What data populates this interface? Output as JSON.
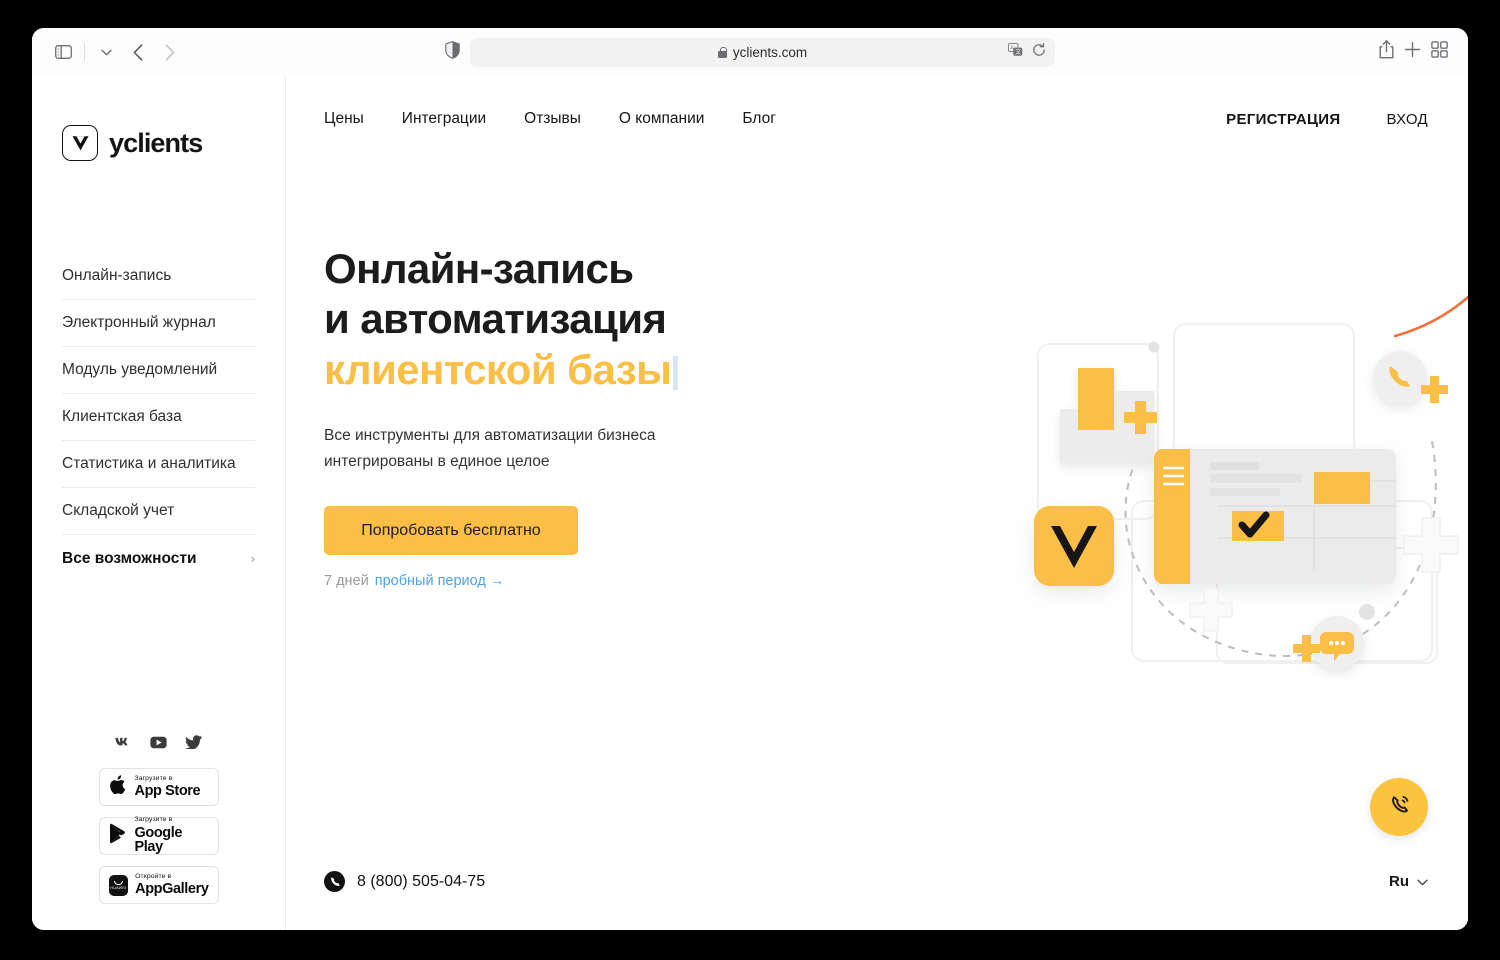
{
  "browser": {
    "url": "yclients.com",
    "icons": {
      "sidebar_toggle": "sidebar-toggle-icon",
      "sidebar_chevron": "chevron-down-icon",
      "back": "back-arrow-icon",
      "forward": "forward-arrow-icon",
      "shield": "privacy-shield-icon",
      "lock": "lock-icon",
      "translate": "translate-icon",
      "reload": "reload-icon",
      "share": "share-icon",
      "new_tab": "plus-icon",
      "tab_overview": "tab-overview-icon"
    },
    "back_label": "‹",
    "forward_label": "›",
    "new_tab_label": "+"
  },
  "sidebar": {
    "logo_text": "yclients",
    "items": [
      {
        "label": "Онлайн-запись"
      },
      {
        "label": "Электронный журнал"
      },
      {
        "label": "Модуль уведомлений"
      },
      {
        "label": "Клиентская база"
      },
      {
        "label": "Статистика и аналитика"
      },
      {
        "label": "Складской учет"
      },
      {
        "label": "Все возможности",
        "chevron": "›"
      }
    ],
    "socials": [
      {
        "name": "vk-icon"
      },
      {
        "name": "youtube-icon"
      },
      {
        "name": "twitter-icon"
      }
    ],
    "badges": [
      {
        "top": "Загрузите в",
        "main": "App Store",
        "icon": "apple-icon"
      },
      {
        "top": "Загрузите в",
        "main": "Google Play",
        "icon": "google-play-icon"
      },
      {
        "top": "Откройте в",
        "main": "AppGallery",
        "icon": "huawei-icon",
        "tile_text": "HUAWEI"
      }
    ]
  },
  "topnav": {
    "links": [
      {
        "label": "Цены"
      },
      {
        "label": "Интеграции"
      },
      {
        "label": "Отзывы"
      },
      {
        "label": "О компании"
      },
      {
        "label": "Блог"
      }
    ],
    "register": "РЕГИСТРАЦИЯ",
    "login": "ВХОД"
  },
  "hero": {
    "headline_line1": "Онлайн-запись",
    "headline_line2": "и автоматизация",
    "headline_line3": "клиентской базы",
    "subtitle_line1": "Все инструменты для автоматизации бизнеса",
    "subtitle_line2": "интегрированы в единое целое",
    "cta_label": "Попробовать бесплатно",
    "trial_days": "7 дней",
    "trial_link": "пробный период →"
  },
  "footer": {
    "phone": "8 (800) 505-04-75",
    "phone_icon": "phone-icon",
    "language": "Ru",
    "language_chevron": "⌄",
    "fab_icon": "phone-call-icon"
  },
  "colors": {
    "brand_yellow": "#FBBE46",
    "cta_yellow": "#FBBE46",
    "fab_yellow": "#FBC43F",
    "link_blue": "#4DA3EC",
    "annotation_orange": "#F4703A",
    "text_dark": "#1C1C1C"
  }
}
